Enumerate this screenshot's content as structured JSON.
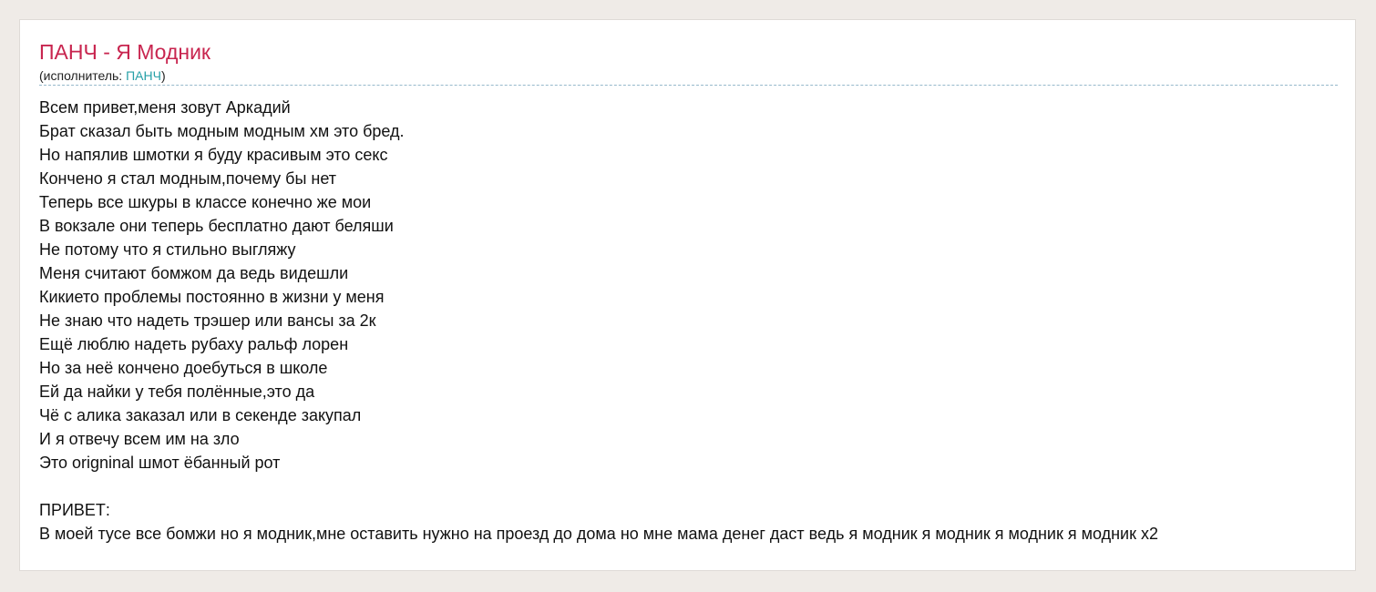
{
  "song": {
    "title": "ПАНЧ - Я Модник",
    "artist_prefix": "(исполнитель: ",
    "artist_name": "ПАНЧ",
    "artist_suffix": ")"
  },
  "lyrics": {
    "verse": [
      "Всем привет,меня зовут Аркадий",
      "Брат сказал быть модным модным хм это бред.",
      "Но напялив шмотки я буду красивым это секс",
      "Кончено я стал модным,почему бы нет",
      "Теперь все шкуры в классе конечно же мои",
      "В вокзале они теперь бесплатно дают беляши",
      "Не потому что я стильно выгляжу",
      "Меня считают бомжом да ведь видешли",
      "Кикието проблемы постоянно в жизни у меня",
      "Не знаю что надеть трэшер или вансы за 2к",
      "Ещё люблю надеть рубаху ральф лорен",
      "Но за неё кончено доебуться в школе",
      "Ей да найки у тебя полённые,это да",
      "Чё с алика заказал или в секенде закупал",
      "И я отвечу всем им на зло",
      "Это origninal шмот ёбанный рот"
    ],
    "chorus_label": "ПРИВЕТ:",
    "chorus_line": "В моей тусе все бомжи но я модник,мне оставить нужно на проезд до дома но мне мама денег даст ведь я модник я модник я модник я модник x2"
  },
  "colors": {
    "background": "#efebe7",
    "title": "#c8254f",
    "link": "#27a0a7",
    "divider": "#96b9cb",
    "text": "#111111"
  }
}
